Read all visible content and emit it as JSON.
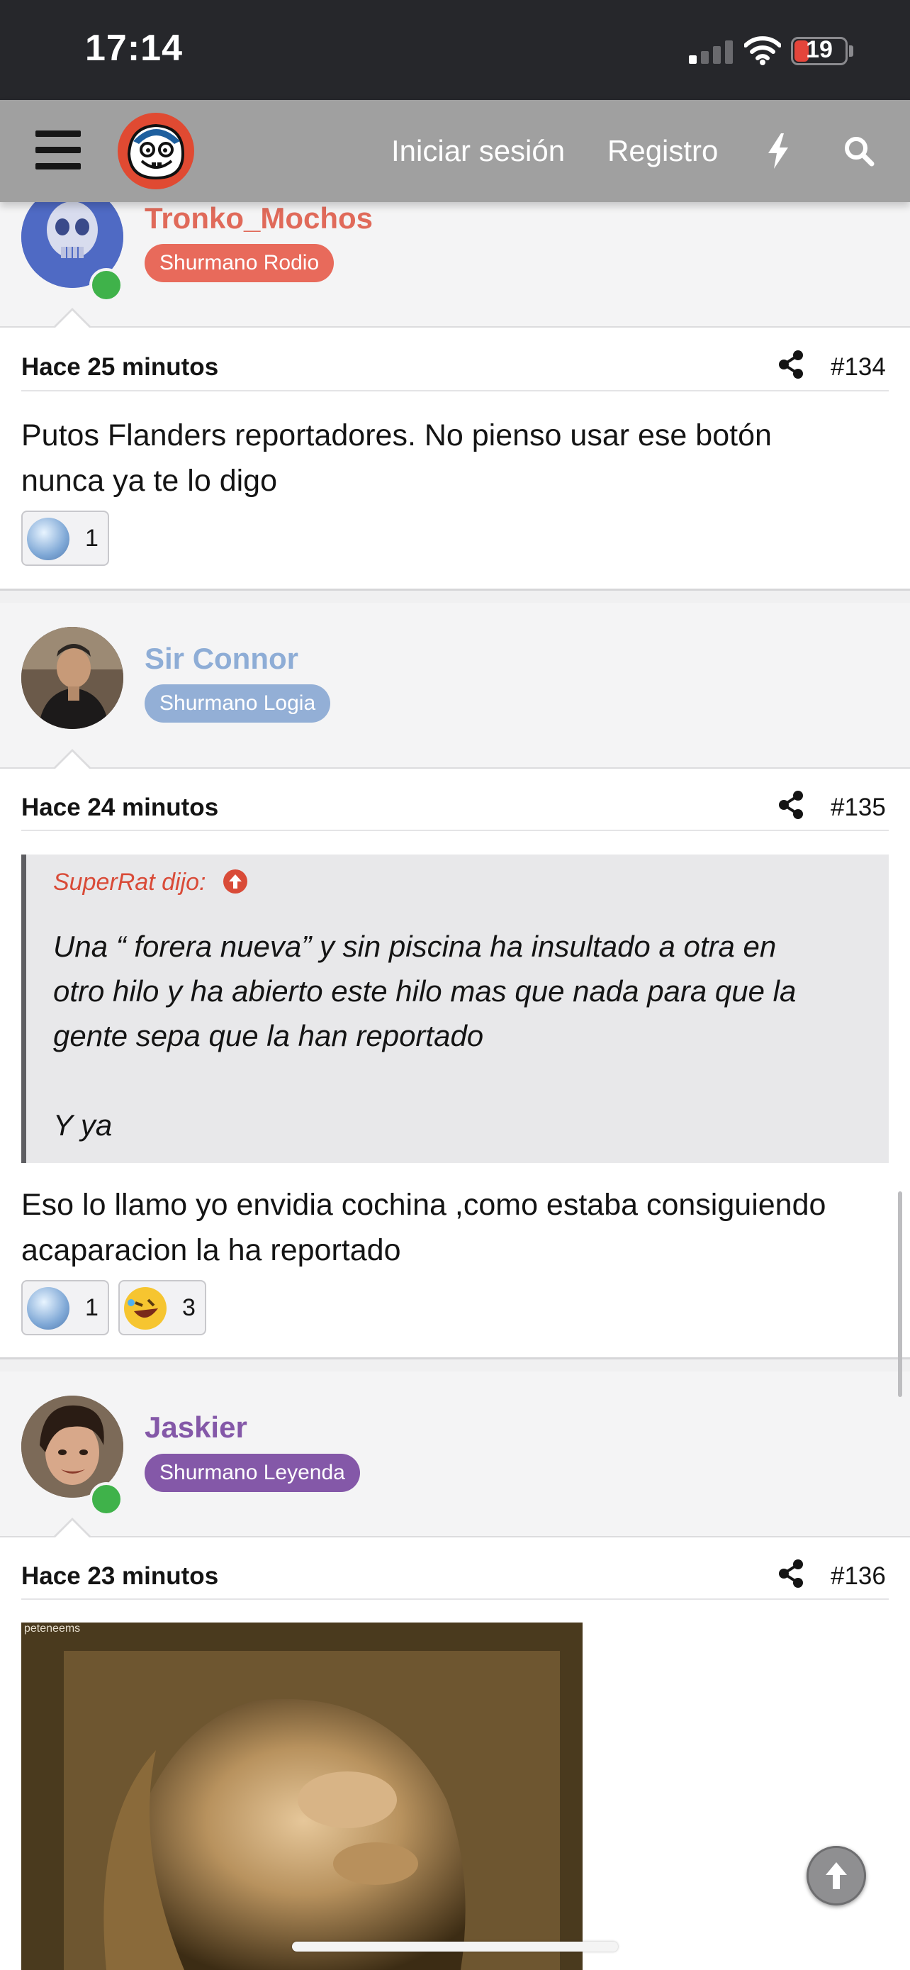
{
  "status_bar": {
    "time": "17:14",
    "battery": "19"
  },
  "nav": {
    "login": "Iniciar sesión",
    "register": "Registro"
  },
  "posts": [
    {
      "username": "Tronko_Mochos",
      "user_color": "#e06a5a",
      "rank": "Shurmano Rodio",
      "rank_color": "#e86a5b",
      "online": true,
      "time_ago": "Hace 25 minutos",
      "post_number": "#134",
      "lines": [
        "Putos Flanders reportadores. No pienso usar ese botón",
        "nunca ya te lo digo"
      ],
      "reactions": [
        {
          "icon": "diamond-icon",
          "count": "1"
        }
      ]
    },
    {
      "username": "Sir Connor",
      "user_color": "#8eadd6",
      "rank": "Shurmano Logia",
      "rank_color": "#93afd6",
      "online": false,
      "time_ago": "Hace 24 minutos",
      "post_number": "#135",
      "quote": {
        "author": "SuperRat dijo:",
        "lines": [
          "Una “ forera nueva” y sin piscina ha insultado a otra en",
          "otro hilo y ha abierto este hilo mas que nada para que la",
          "gente sepa que la han reportado",
          "",
          "Y ya"
        ]
      },
      "lines": [
        "Eso lo llamo yo envidia cochina ,como estaba consiguiendo",
        "acaparacion la ha reportado"
      ],
      "reactions": [
        {
          "icon": "diamond-icon",
          "count": "1"
        },
        {
          "icon": "rofl-emoji-icon",
          "count": "3"
        }
      ]
    },
    {
      "username": "Jaskier",
      "user_color": "#8458a8",
      "rank": "Shurmano Leyenda",
      "rank_color": "#8458a8",
      "online": true,
      "time_ago": "Hace 23 minutos",
      "post_number": "#136",
      "gif_watermark": "peteneems"
    }
  ]
}
